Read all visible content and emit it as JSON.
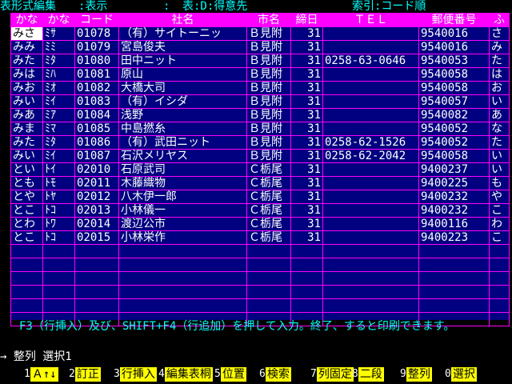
{
  "status": {
    "mode": "表形式編集",
    "view": ":表示",
    "colon": ":",
    "table": "表:D:得意先",
    "index": "索引:コード順"
  },
  "columns": [
    "かな",
    "かな",
    "コード",
    "社名",
    "市名",
    "締日",
    "ＴＥＬ",
    "郵便番号",
    "ふ"
  ],
  "rows": [
    [
      "みさ",
      "ﾐｻ",
      "01078",
      "（有）サイトーニッ",
      "Ｂ見附",
      "31",
      "",
      "9540016",
      "さ"
    ],
    [
      "みみ",
      "ﾐﾐ",
      "01079",
      "宮島俊夫",
      "Ｂ見附",
      "31",
      "",
      "9540016",
      "み"
    ],
    [
      "みた",
      "ﾐﾀ",
      "01080",
      "田中ニット",
      "Ｂ見附",
      "31",
      "0258-63-0646",
      "9540053",
      "た"
    ],
    [
      "みは",
      "ﾐﾊ",
      "01081",
      "原山",
      "Ｂ見附",
      "31",
      "",
      "9540058",
      "は"
    ],
    [
      "みお",
      "ﾐｵ",
      "01082",
      "大橋大司",
      "Ｂ見附",
      "31",
      "",
      "9540058",
      "お"
    ],
    [
      "みい",
      "ﾐｲ",
      "01083",
      "（有）イシダ",
      "Ｂ見附",
      "31",
      "",
      "9540057",
      "い"
    ],
    [
      "みあ",
      "ﾐｱ",
      "01084",
      "浅野",
      "Ｂ見附",
      "31",
      "",
      "9540082",
      "あ"
    ],
    [
      "みま",
      "ﾐﾏ",
      "01085",
      "中島撚糸",
      "Ｂ見附",
      "31",
      "",
      "9540052",
      "な"
    ],
    [
      "みた",
      "ﾐﾀ",
      "01086",
      "（有）武田ニット",
      "Ｂ見附",
      "31",
      "0258-62-1526",
      "9540052",
      "た"
    ],
    [
      "みい",
      "ﾐｲ",
      "01087",
      "石沢メリヤス",
      "Ｂ見附",
      "31",
      "0258-62-2042",
      "9540058",
      "い"
    ],
    [
      "とい",
      "ﾄｲ",
      "02010",
      "石原武司",
      "Ｃ栃尾",
      "31",
      "",
      "9400237",
      "い"
    ],
    [
      "とも",
      "ﾄﾓ",
      "02011",
      "木藤織物",
      "Ｃ栃尾",
      "31",
      "",
      "9400225",
      "も"
    ],
    [
      "とや",
      "ﾄﾔ",
      "02012",
      "八木伊一郎",
      "Ｃ栃尾",
      "31",
      "",
      "9400232",
      "や"
    ],
    [
      "とこ",
      "ﾄｺ",
      "02013",
      "小林儀一",
      "Ｃ栃尾",
      "31",
      "",
      "9400232",
      "こ"
    ],
    [
      "とわ",
      "ﾄﾜ",
      "02014",
      "渡辺公市",
      "Ｃ栃尾",
      "31",
      "",
      "9400116",
      "わ"
    ],
    [
      "とこ",
      "ﾄｺ",
      "02015",
      "小林栄作",
      "Ｃ栃尾",
      "31",
      "",
      "9400223",
      "こ"
    ]
  ],
  "hint": "F3（行挿入）及び、SHIFT+F4（行追加）を押して入力。終了、すると印刷できます。",
  "command": "→ 整列 選択1",
  "fkeys": [
    {
      "num": "1",
      "label": "Ａ↑↓"
    },
    {
      "num": "2",
      "label": "訂正"
    },
    {
      "num": "3",
      "label": "行挿入"
    },
    {
      "num": "4",
      "label": "編集表桐"
    },
    {
      "num": "5",
      "label": "位置"
    },
    {
      "num": "6",
      "label": "検索"
    },
    {
      "num": "7",
      "label": "列固定"
    },
    {
      "num": "8",
      "label": "二段"
    },
    {
      "num": "9",
      "label": "整列"
    },
    {
      "num": "0",
      "label": "選択"
    }
  ],
  "colors": {
    "background": "#000000",
    "grid": "#000080",
    "header": "#ff00ff",
    "status": "#00ffff",
    "fkey": "#ffff00"
  }
}
